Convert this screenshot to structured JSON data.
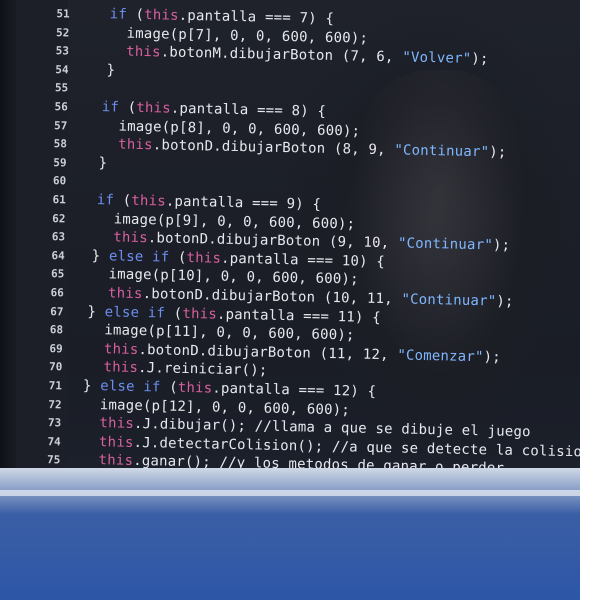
{
  "editor": {
    "lines": [
      {
        "n": "51",
        "segs": [
          [
            "kw",
            "if "
          ],
          [
            "p",
            "("
          ],
          [
            "th",
            "this"
          ],
          [
            "p",
            ".pantalla === 7) {"
          ]
        ]
      },
      {
        "n": "52",
        "segs": [
          [
            "p",
            "  image(p[7], 0, 0, 600, 600);"
          ]
        ]
      },
      {
        "n": "53",
        "segs": [
          [
            "th",
            "  this"
          ],
          [
            "p",
            ".botonM.dibujarBoton (7, 6, "
          ],
          [
            "st",
            "\"Volver\""
          ],
          [
            "p",
            ");"
          ]
        ]
      },
      {
        "n": "54",
        "segs": [
          [
            "p",
            "}"
          ]
        ]
      },
      {
        "n": "55",
        "segs": []
      },
      {
        "n": "56",
        "segs": [
          [
            "kw",
            "if "
          ],
          [
            "p",
            "("
          ],
          [
            "th",
            "this"
          ],
          [
            "p",
            ".pantalla === 8) {"
          ]
        ]
      },
      {
        "n": "57",
        "segs": [
          [
            "p",
            "  image(p[8], 0, 0, 600, 600);"
          ]
        ]
      },
      {
        "n": "58",
        "segs": [
          [
            "th",
            "  this"
          ],
          [
            "p",
            ".botonD.dibujarBoton (8, 9, "
          ],
          [
            "st",
            "\"Continuar\""
          ],
          [
            "p",
            ");"
          ]
        ]
      },
      {
        "n": "59",
        "segs": [
          [
            "p",
            "}"
          ]
        ]
      },
      {
        "n": "60",
        "segs": []
      },
      {
        "n": "61",
        "segs": [
          [
            "kw",
            "if "
          ],
          [
            "p",
            "("
          ],
          [
            "th",
            "this"
          ],
          [
            "p",
            ".pantalla === 9) {"
          ]
        ]
      },
      {
        "n": "62",
        "segs": [
          [
            "p",
            "  image(p[9], 0, 0, 600, 600);"
          ]
        ]
      },
      {
        "n": "63",
        "segs": [
          [
            "th",
            "  this"
          ],
          [
            "p",
            ".botonD.dibujarBoton (9, 10, "
          ],
          [
            "st",
            "\"Continuar\""
          ],
          [
            "p",
            ");"
          ]
        ]
      },
      {
        "n": "64",
        "segs": [
          [
            "p",
            "} "
          ],
          [
            "kw",
            "else if "
          ],
          [
            "p",
            "("
          ],
          [
            "th",
            "this"
          ],
          [
            "p",
            ".pantalla === 10) {"
          ]
        ]
      },
      {
        "n": "65",
        "segs": [
          [
            "p",
            "  image(p[10], 0, 0, 600, 600);"
          ]
        ]
      },
      {
        "n": "66",
        "segs": [
          [
            "th",
            "  this"
          ],
          [
            "p",
            ".botonD.dibujarBoton (10, 11, "
          ],
          [
            "st",
            "\"Continuar\""
          ],
          [
            "p",
            ");"
          ]
        ]
      },
      {
        "n": "67",
        "segs": [
          [
            "p",
            "} "
          ],
          [
            "kw",
            "else if "
          ],
          [
            "p",
            "("
          ],
          [
            "th",
            "this"
          ],
          [
            "p",
            ".pantalla === 11) {"
          ]
        ]
      },
      {
        "n": "68",
        "segs": [
          [
            "p",
            "  image(p[11], 0, 0, 600, 600);"
          ]
        ]
      },
      {
        "n": "69",
        "segs": [
          [
            "th",
            "  this"
          ],
          [
            "p",
            ".botonD.dibujarBoton (11, 12, "
          ],
          [
            "st",
            "\"Comenzar\""
          ],
          [
            "p",
            ");"
          ]
        ]
      },
      {
        "n": "70",
        "segs": [
          [
            "th",
            "  this"
          ],
          [
            "p",
            ".J.reiniciar();"
          ]
        ]
      },
      {
        "n": "71",
        "segs": [
          [
            "p",
            "} "
          ],
          [
            "kw",
            "else if "
          ],
          [
            "p",
            "("
          ],
          [
            "th",
            "this"
          ],
          [
            "p",
            ".pantalla === 12) {"
          ]
        ]
      },
      {
        "n": "72",
        "segs": [
          [
            "p",
            "  image(p[12], 0, 0, 600, 600);"
          ]
        ]
      },
      {
        "n": "73",
        "segs": [
          [
            "th",
            "  this"
          ],
          [
            "p",
            ".J.dibujar(); //llama a que se dibuje el juego"
          ]
        ]
      },
      {
        "n": "74",
        "segs": [
          [
            "th",
            "  this"
          ],
          [
            "p",
            ".J.detectarColision(); //a que se detecte la colision"
          ]
        ]
      },
      {
        "n": "75",
        "segs": [
          [
            "th",
            "  this"
          ],
          [
            "p",
            ".ganar(); //y los metodos de ganar o perder"
          ]
        ]
      }
    ]
  },
  "colors": {
    "keyword": "#6c8ef0",
    "this": "#d75fa0",
    "string": "#7fb6ff",
    "plain": "#e6e8ee"
  }
}
